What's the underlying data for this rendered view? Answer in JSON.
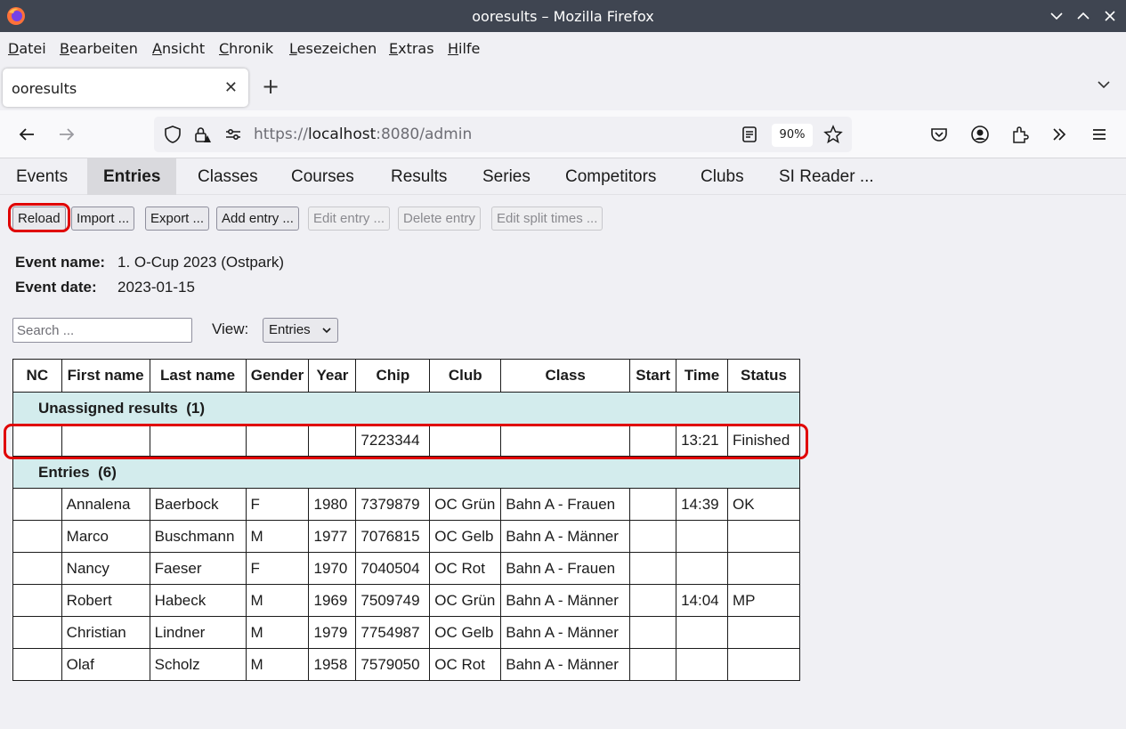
{
  "window": {
    "title": "ooresults – Mozilla Firefox"
  },
  "menu": [
    "Datei",
    "Bearbeiten",
    "Ansicht",
    "Chronik",
    "Lesezeichen",
    "Extras",
    "Hilfe"
  ],
  "tab": {
    "title": "ooresults",
    "close": "✕",
    "new": "+"
  },
  "navbar": {
    "url_prefix": "https://",
    "url_host": "localhost",
    "url_rest": ":8080/admin",
    "zoom": "90%"
  },
  "app_tabs": [
    "Events",
    "Entries",
    "Classes",
    "Courses",
    "Results",
    "Series",
    "Competitors",
    "Clubs",
    "SI Reader ..."
  ],
  "active_tab": "Entries",
  "toolbar": {
    "reload": "Reload",
    "import": "Import ...",
    "export": "Export ...",
    "add_entry": "Add entry ...",
    "edit_entry": "Edit entry ...",
    "delete_entry": "Delete entry",
    "edit_split_times": "Edit split times ..."
  },
  "event": {
    "name_label": "Event name:",
    "name": "1. O-Cup 2023 (Ostpark)",
    "date_label": "Event date:",
    "date": "2023-01-15"
  },
  "filter": {
    "search_placeholder": "Search ...",
    "view_label": "View:",
    "view_value": "Entries"
  },
  "table": {
    "columns": [
      "NC",
      "First name",
      "Last name",
      "Gender",
      "Year",
      "Chip",
      "Club",
      "Class",
      "Start",
      "Time",
      "Status"
    ],
    "groups": [
      {
        "label": "Unassigned results  (1)",
        "rows": [
          [
            "",
            "",
            "",
            "",
            "",
            "7223344",
            "",
            "",
            "",
            "13:21",
            "Finished"
          ]
        ]
      },
      {
        "label": "Entries  (6)",
        "rows": [
          [
            "",
            "Annalena",
            "Baerbock",
            "F",
            "1980",
            "7379879",
            "OC Grün",
            "Bahn A - Frauen",
            "",
            "14:39",
            "OK"
          ],
          [
            "",
            "Marco",
            "Buschmann",
            "M",
            "1977",
            "7076815",
            "OC Gelb",
            "Bahn A - Männer",
            "",
            "",
            ""
          ],
          [
            "",
            "Nancy",
            "Faeser",
            "F",
            "1970",
            "7040504",
            "OC Rot",
            "Bahn A - Frauen",
            "",
            "",
            ""
          ],
          [
            "",
            "Robert",
            "Habeck",
            "M",
            "1969",
            "7509749",
            "OC Grün",
            "Bahn A - Männer",
            "",
            "14:04",
            "MP"
          ],
          [
            "",
            "Christian",
            "Lindner",
            "M",
            "1979",
            "7754987",
            "OC Gelb",
            "Bahn A - Männer",
            "",
            "",
            ""
          ],
          [
            "",
            "Olaf",
            "Scholz",
            "M",
            "1958",
            "7579050",
            "OC Rot",
            "Bahn A - Männer",
            "",
            "",
            ""
          ]
        ]
      }
    ]
  },
  "colors": {
    "group_row": "#d3eced",
    "highlight": "#e00000",
    "titlebar": "#3f4551"
  }
}
